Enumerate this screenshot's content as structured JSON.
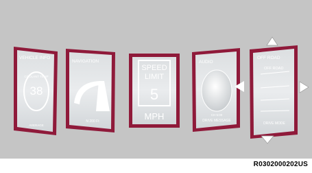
{
  "panels": [
    {
      "title": "VEHICLE INFO",
      "subtitle": "COOLANT TEMP",
      "value": "38",
      "footer": "AVERAGE"
    },
    {
      "title": "NAVIGATION",
      "footer": "N 200 Ft"
    },
    {
      "line1": "SPEED",
      "line2": "LIMIT",
      "value": "5",
      "unit": "MPH"
    },
    {
      "title": "AUDIO",
      "meta": "CH 5:00",
      "footer": "DRIVE MESSAGE"
    },
    {
      "title": "OFF ROAD",
      "subtitle": "OFF ROAD",
      "footer": "DRIVE MODE"
    }
  ],
  "figure_id": "R0302000202US",
  "colors": {
    "frame": "#8f1a3a",
    "screen": "#cfd3d6",
    "screen_center": "#ededed",
    "background": "#c5c5c5",
    "arrow": "#ffffff"
  }
}
